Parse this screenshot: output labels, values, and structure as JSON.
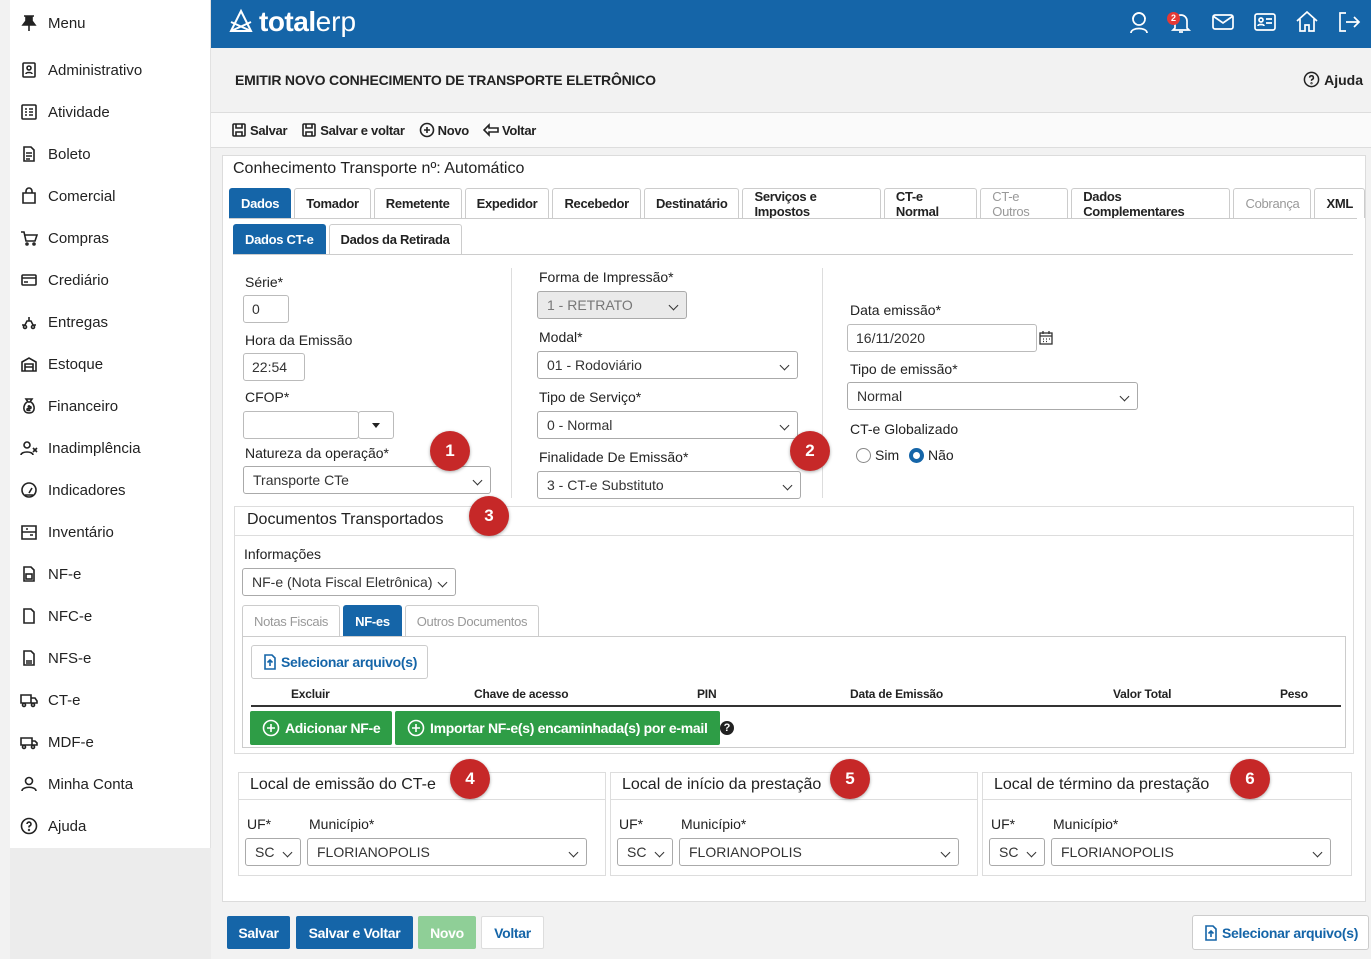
{
  "sidebar": {
    "items": [
      {
        "label": "Menu",
        "icon": "pin-icon"
      },
      {
        "label": "Administrativo",
        "icon": "id-badge-icon"
      },
      {
        "label": "Atividade",
        "icon": "list-icon"
      },
      {
        "label": "Boleto",
        "icon": "document-icon"
      },
      {
        "label": "Comercial",
        "icon": "shopping-bag-icon"
      },
      {
        "label": "Compras",
        "icon": "cart-icon"
      },
      {
        "label": "Crediário",
        "icon": "credit-card-icon"
      },
      {
        "label": "Entregas",
        "icon": "delivery-icon"
      },
      {
        "label": "Estoque",
        "icon": "warehouse-icon"
      },
      {
        "label": "Financeiro",
        "icon": "money-bag-icon"
      },
      {
        "label": "Inadimplência",
        "icon": "user-x-icon"
      },
      {
        "label": "Indicadores",
        "icon": "gauge-icon"
      },
      {
        "label": "Inventário",
        "icon": "shelf-icon"
      },
      {
        "label": "NF-e",
        "icon": "invoice-icon"
      },
      {
        "label": "NFC-e",
        "icon": "file-icon"
      },
      {
        "label": "NFS-e",
        "icon": "file-lines-icon"
      },
      {
        "label": "CT-e",
        "icon": "truck-icon"
      },
      {
        "label": "MDF-e",
        "icon": "van-icon"
      },
      {
        "label": "Minha Conta",
        "icon": "user-icon"
      },
      {
        "label": "Ajuda",
        "icon": "help-icon"
      }
    ]
  },
  "topbar": {
    "logo_bold": "total",
    "logo_light": "erp",
    "notification_count": "2"
  },
  "header": {
    "title": "EMITIR NOVO CONHECIMENTO DE TRANSPORTE ELETRÔNICO",
    "help": "Ajuda"
  },
  "toolbar": {
    "save": "Salvar",
    "save_back": "Salvar e voltar",
    "new": "Novo",
    "back": "Voltar"
  },
  "panel": {
    "title": "Conhecimento Transporte nº: Automático"
  },
  "tabs": [
    "Dados",
    "Tomador",
    "Remetente",
    "Expedidor",
    "Recebedor",
    "Destinatário",
    "Serviços e Impostos",
    "CT-e Normal",
    "CT-e Outros",
    "Dados Complementares",
    "Cobrança",
    "XML"
  ],
  "subtabs": [
    "Dados CT-e",
    "Dados da Retirada"
  ],
  "form": {
    "serie_label": "Série*",
    "serie_value": "0",
    "hora_label": "Hora da Emissão",
    "hora_value": "22:54",
    "cfop_label": "CFOP*",
    "natureza_label": "Natureza da operação*",
    "natureza_value": "Transporte CTe",
    "impressao_label": "Forma de Impressão*",
    "impressao_value": "1 - RETRATO",
    "modal_label": "Modal*",
    "modal_value": "01 - Rodoviário",
    "servico_label": "Tipo de Serviço*",
    "servico_value": "0 - Normal",
    "finalidade_label": "Finalidade De Emissão*",
    "finalidade_value": "3 - CT-e Substituto",
    "data_label": "Data emissão*",
    "data_value": "16/11/2020",
    "tipo_emissao_label": "Tipo de emissão*",
    "tipo_emissao_value": "Normal",
    "globalizado_label": "CT-e Globalizado",
    "sim": "Sim",
    "nao": "Não"
  },
  "docs": {
    "title": "Documentos Transportados",
    "info_label": "Informações",
    "info_value": "NF-e (Nota Fiscal Eletrônica)",
    "tabs": [
      "Notas Fiscais",
      "NF-es",
      "Outros Documentos"
    ],
    "select_file": "Selecionar arquivo(s)",
    "columns": [
      "Excluir",
      "Chave de acesso",
      "PIN",
      "Data de Emissão",
      "Valor Total",
      "Peso"
    ],
    "add_nfe": "Adicionar NF-e",
    "import_nfe": "Importar NF-e(s) encaminhada(s) por e-mail"
  },
  "locais": [
    {
      "title": "Local de emissão do CT-e",
      "uf_label": "UF*",
      "mun_label": "Município*",
      "uf": "SC",
      "mun": "FLORIANOPOLIS"
    },
    {
      "title": "Local de início da prestação",
      "uf_label": "UF*",
      "mun_label": "Município*",
      "uf": "SC",
      "mun": "FLORIANOPOLIS"
    },
    {
      "title": "Local de término da prestação",
      "uf_label": "UF*",
      "mun_label": "Município*",
      "uf": "SC",
      "mun": "FLORIANOPOLIS"
    }
  ],
  "markers": [
    "1",
    "2",
    "3",
    "4",
    "5",
    "6"
  ],
  "footer": {
    "save": "Salvar",
    "save_back": "Salvar e Voltar",
    "new": "Novo",
    "back": "Voltar",
    "select_file": "Selecionar arquivo(s)"
  },
  "colors": {
    "primary": "#1565a8",
    "green": "#2e9d46",
    "marker": "#c62828"
  }
}
